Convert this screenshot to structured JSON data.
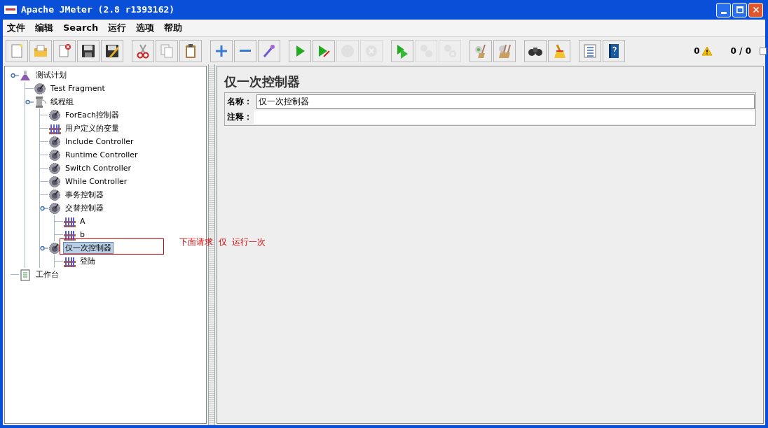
{
  "window": {
    "title": "Apache JMeter (2.8 r1393162)"
  },
  "menu": [
    {
      "label": "文件"
    },
    {
      "label": "编辑"
    },
    {
      "label": "Search"
    },
    {
      "label": "运行"
    },
    {
      "label": "选项"
    },
    {
      "label": "帮助"
    }
  ],
  "toolbar_groups": [
    [
      {
        "kind": "new",
        "disabled": false
      },
      {
        "kind": "open",
        "disabled": false
      },
      {
        "kind": "close",
        "disabled": false
      },
      {
        "kind": "save",
        "disabled": false
      },
      {
        "kind": "save_as",
        "disabled": false
      }
    ],
    [
      {
        "kind": "cut",
        "disabled": false
      },
      {
        "kind": "copy",
        "disabled": false
      },
      {
        "kind": "paste",
        "disabled": false
      }
    ],
    [
      {
        "kind": "expand",
        "disabled": false
      },
      {
        "kind": "collapse",
        "disabled": false
      },
      {
        "kind": "toggle",
        "disabled": false
      }
    ],
    [
      {
        "kind": "start",
        "disabled": false
      },
      {
        "kind": "start_no_timers",
        "disabled": false
      },
      {
        "kind": "stop",
        "disabled": true
      },
      {
        "kind": "shutdown",
        "disabled": true
      }
    ],
    [
      {
        "kind": "remote_start",
        "disabled": false
      },
      {
        "kind": "remote_stop",
        "disabled": true
      },
      {
        "kind": "remote_exit",
        "disabled": true
      }
    ],
    [
      {
        "kind": "clear",
        "disabled": false
      },
      {
        "kind": "clear_all",
        "disabled": false
      }
    ],
    [
      {
        "kind": "search",
        "disabled": false
      },
      {
        "kind": "reset_search",
        "disabled": false
      }
    ],
    [
      {
        "kind": "function_helper",
        "disabled": false
      },
      {
        "kind": "help",
        "disabled": false
      }
    ]
  ],
  "status": {
    "error_count": "0",
    "threads": "0 / 0"
  },
  "tree": [
    {
      "label": "测试计划",
      "kind": "plan",
      "selected": false,
      "expanded": true,
      "children": [
        {
          "label": "Test Fragment",
          "kind": "controller",
          "selected": false
        },
        {
          "label": "线程组",
          "kind": "thread_group",
          "selected": false,
          "expanded": true,
          "children": [
            {
              "label": "ForEach控制器",
              "kind": "controller",
              "selected": false
            },
            {
              "label": "用户定义的变量",
              "kind": "config",
              "selected": false
            },
            {
              "label": "Include Controller",
              "kind": "controller",
              "selected": false
            },
            {
              "label": "Runtime Controller",
              "kind": "controller",
              "selected": false
            },
            {
              "label": "Switch Controller",
              "kind": "controller",
              "selected": false
            },
            {
              "label": "While Controller",
              "kind": "controller",
              "selected": false
            },
            {
              "label": "事务控制器",
              "kind": "controller",
              "selected": false
            },
            {
              "label": "交替控制器",
              "kind": "controller",
              "selected": false,
              "expanded": true,
              "children": [
                {
                  "label": "A",
                  "kind": "config",
                  "selected": false
                },
                {
                  "label": "b",
                  "kind": "config",
                  "selected": false
                }
              ]
            },
            {
              "label": "仅一次控制器",
              "kind": "controller",
              "selected": true,
              "expanded": true,
              "children": [
                {
                  "label": "登陆",
                  "kind": "config",
                  "selected": false
                }
              ]
            }
          ]
        }
      ]
    },
    {
      "label": "工作台",
      "kind": "workbench",
      "selected": false
    }
  ],
  "annotation": {
    "text": "下面请求  仅  运行一次"
  },
  "editor": {
    "title": "仅一次控制器",
    "name_label": "名称：",
    "name_value": "仅一次控制器",
    "comment_label": "注释："
  }
}
